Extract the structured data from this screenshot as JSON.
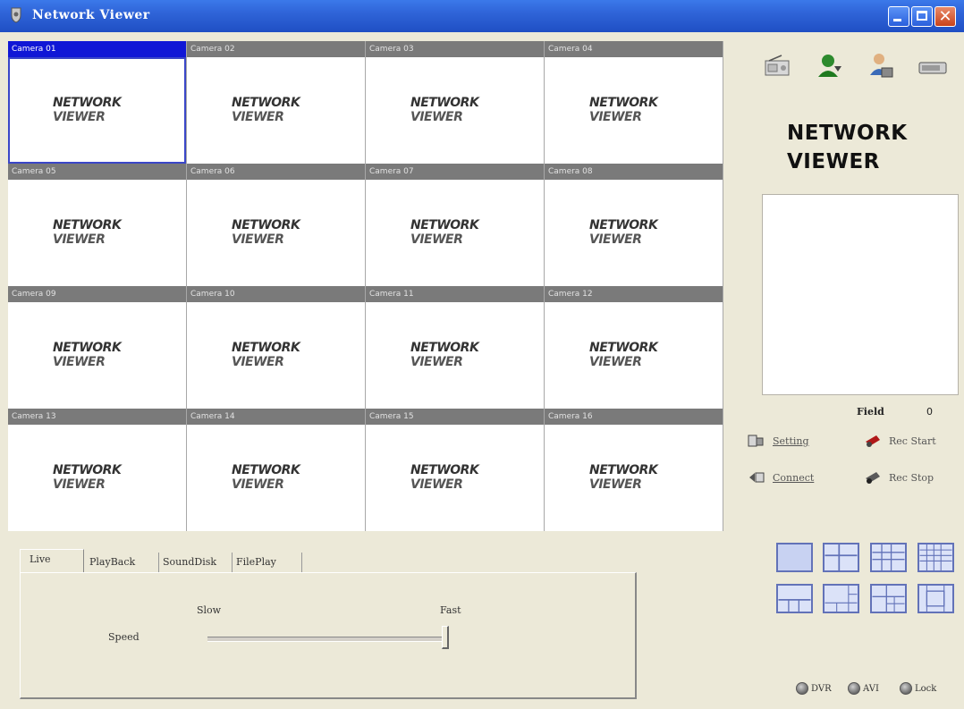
{
  "window": {
    "title": "Network Viewer",
    "controls": {
      "minimize": "minimize",
      "maximize": "maximize",
      "close": "✕"
    }
  },
  "cameras": [
    {
      "label": "Camera 01",
      "selected": true
    },
    {
      "label": "Camera 02"
    },
    {
      "label": "Camera 03"
    },
    {
      "label": "Camera 04"
    },
    {
      "label": "Camera 05"
    },
    {
      "label": "Camera 06"
    },
    {
      "label": "Camera 07"
    },
    {
      "label": "Camera 08"
    },
    {
      "label": "Camera 09"
    },
    {
      "label": "Camera 10"
    },
    {
      "label": "Camera 11"
    },
    {
      "label": "Camera 12"
    },
    {
      "label": "Camera 13"
    },
    {
      "label": "Camera 14"
    },
    {
      "label": "Camera 15"
    },
    {
      "label": "Camera 16"
    }
  ],
  "camera_logo": {
    "line1": "NETWORK",
    "line2": "VIEWER"
  },
  "toolbar_icons": [
    "radio-icon",
    "user-connect-icon",
    "user-settings-icon",
    "device-icon"
  ],
  "brand": {
    "line1": "NETWORK",
    "line2": "VIEWER"
  },
  "field": {
    "label": "Field",
    "value": "0"
  },
  "actions": {
    "setting": "Setting",
    "connect": "Connect",
    "rec_start": "Rec Start",
    "rec_stop": "Rec Stop"
  },
  "layouts": [
    "1x1",
    "2x2",
    "3x3",
    "4x4",
    "1+3",
    "1+5",
    "1+7",
    "1+12"
  ],
  "modes": [
    {
      "label": "DVR"
    },
    {
      "label": "AVI"
    },
    {
      "label": "Lock"
    }
  ],
  "tabs": [
    "Live",
    "PlayBack",
    "SoundDisk",
    "FilePlay"
  ],
  "playback": {
    "slow_label": "Slow",
    "fast_label": "Fast",
    "speed_label": "Speed",
    "speed_level": 1.0
  },
  "colors": {
    "title_blue": "#2f64d8",
    "selected_header": "#1017d6",
    "camera_header": "#7a7a7a"
  }
}
